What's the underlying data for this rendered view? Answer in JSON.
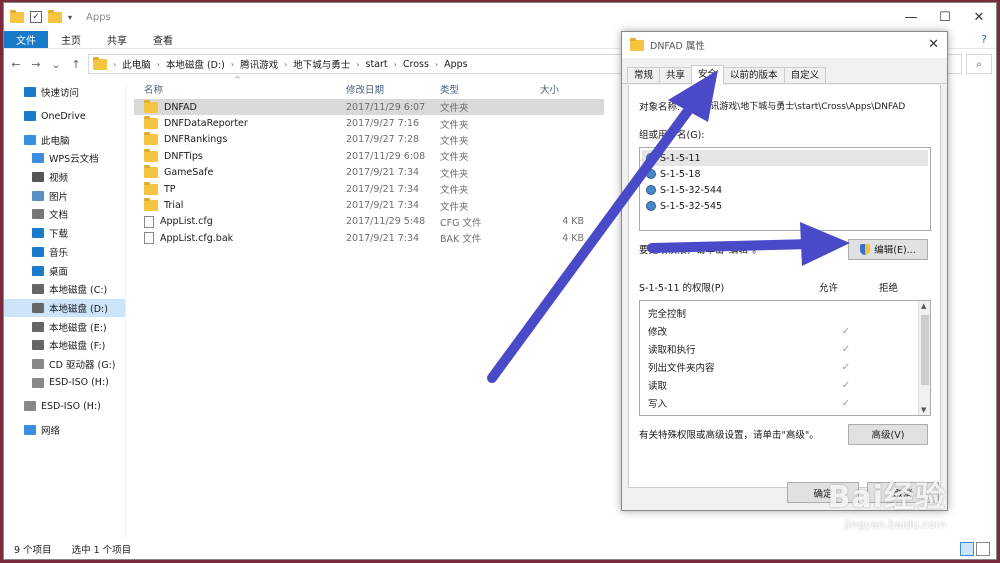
{
  "explorer": {
    "title": "Apps",
    "ribbon": {
      "file": "文件",
      "home": "主页",
      "share": "共享",
      "view": "查看"
    },
    "path": [
      "此电脑",
      "本地磁盘 (D:)",
      "腾讯游戏",
      "地下城与勇士",
      "start",
      "Cross",
      "Apps"
    ],
    "columns": {
      "name": "名称",
      "date": "修改日期",
      "type": "类型",
      "size": "大小"
    },
    "nav": [
      {
        "label": "快速访问",
        "icon": "star-icon",
        "color": "#1979ca"
      },
      {
        "label": "OneDrive",
        "icon": "cloud-icon",
        "color": "#1979ca"
      },
      {
        "label": "此电脑",
        "icon": "computer-icon",
        "color": "#3a8ee0"
      },
      {
        "label": "WPS云文档",
        "icon": "cloud-doc-icon",
        "color": "#3a8ee0"
      },
      {
        "label": "视频",
        "icon": "video-icon",
        "color": "#555555"
      },
      {
        "label": "图片",
        "icon": "pictures-icon",
        "color": "#5a8fc2"
      },
      {
        "label": "文档",
        "icon": "documents-icon",
        "color": "#777777"
      },
      {
        "label": "下载",
        "icon": "download-icon",
        "color": "#1979ca"
      },
      {
        "label": "音乐",
        "icon": "music-icon",
        "color": "#1979ca"
      },
      {
        "label": "桌面",
        "icon": "desktop-icon",
        "color": "#1979ca"
      },
      {
        "label": "本地磁盘 (C:)",
        "icon": "drive-icon",
        "color": "#666666"
      },
      {
        "label": "本地磁盘 (D:)",
        "icon": "drive-icon",
        "color": "#666666"
      },
      {
        "label": "本地磁盘 (E:)",
        "icon": "drive-icon",
        "color": "#666666"
      },
      {
        "label": "本地磁盘 (F:)",
        "icon": "drive-icon",
        "color": "#666666"
      },
      {
        "label": "CD 驱动器 (G:)",
        "icon": "cd-drive-icon",
        "color": "#888888"
      },
      {
        "label": "ESD-ISO (H:)",
        "icon": "usb-drive-icon",
        "color": "#888888"
      },
      {
        "label": "ESD-ISO (H:)",
        "icon": "usb-drive-icon",
        "color": "#888888"
      },
      {
        "label": "网络",
        "icon": "network-icon",
        "color": "#3a8ee0"
      }
    ],
    "files": [
      {
        "name": "DNFAD",
        "date": "2017/11/29 6:07",
        "type": "文件夹",
        "size": "",
        "folder": true,
        "selected": true
      },
      {
        "name": "DNFDataReporter",
        "date": "2017/9/27 7:16",
        "type": "文件夹",
        "size": "",
        "folder": true
      },
      {
        "name": "DNFRankings",
        "date": "2017/9/27 7:28",
        "type": "文件夹",
        "size": "",
        "folder": true
      },
      {
        "name": "DNFTips",
        "date": "2017/11/29 6:08",
        "type": "文件夹",
        "size": "",
        "folder": true
      },
      {
        "name": "GameSafe",
        "date": "2017/9/21 7:34",
        "type": "文件夹",
        "size": "",
        "folder": true
      },
      {
        "name": "TP",
        "date": "2017/9/21 7:34",
        "type": "文件夹",
        "size": "",
        "folder": true
      },
      {
        "name": "Trial",
        "date": "2017/9/21 7:34",
        "type": "文件夹",
        "size": "",
        "folder": true
      },
      {
        "name": "AppList.cfg",
        "date": "2017/11/29 5:48",
        "type": "CFG 文件",
        "size": "4 KB",
        "folder": false
      },
      {
        "name": "AppList.cfg.bak",
        "date": "2017/9/21 7:34",
        "type": "BAK 文件",
        "size": "4 KB",
        "folder": false
      }
    ],
    "status": {
      "count": "9 个项目",
      "selected": "选中 1 个项目"
    }
  },
  "dialog": {
    "title": "DNFAD 属性",
    "tabs": [
      "常规",
      "共享",
      "安全",
      "以前的版本",
      "自定义"
    ],
    "active_tab": 2,
    "object_label": "对象名称:",
    "object_value": "D:\\腾讯游戏\\地下城与勇士\\start\\Cross\\Apps\\DNFAD",
    "group_label": "组或用户名(G):",
    "users": [
      "S-1-5-11",
      "S-1-5-18",
      "S-1-5-32-544",
      "S-1-5-32-545"
    ],
    "edit_hint": "要更改权限，请单击\"编辑\"。",
    "edit_button": "编辑(E)...",
    "perm_label": "S-1-5-11 的权限(P)",
    "allow": "允许",
    "deny": "拒绝",
    "permissions": [
      {
        "name": "完全控制",
        "allow": ""
      },
      {
        "name": "修改",
        "allow": "✓"
      },
      {
        "name": "读取和执行",
        "allow": "✓"
      },
      {
        "name": "列出文件夹内容",
        "allow": "✓"
      },
      {
        "name": "读取",
        "allow": "✓"
      },
      {
        "name": "写入",
        "allow": "✓"
      }
    ],
    "adv_hint": "有关特殊权限或高级设置，请单击\"高级\"。",
    "adv_button": "高级(V)",
    "ok": "确定",
    "cancel": "取消"
  },
  "watermark": {
    "brand": "Bai经验",
    "url": "jingyan.baidu.com"
  },
  "colors": {
    "accent": "#1979ca",
    "arrow": "#4a4ac8",
    "selection": "#cce4f7"
  }
}
